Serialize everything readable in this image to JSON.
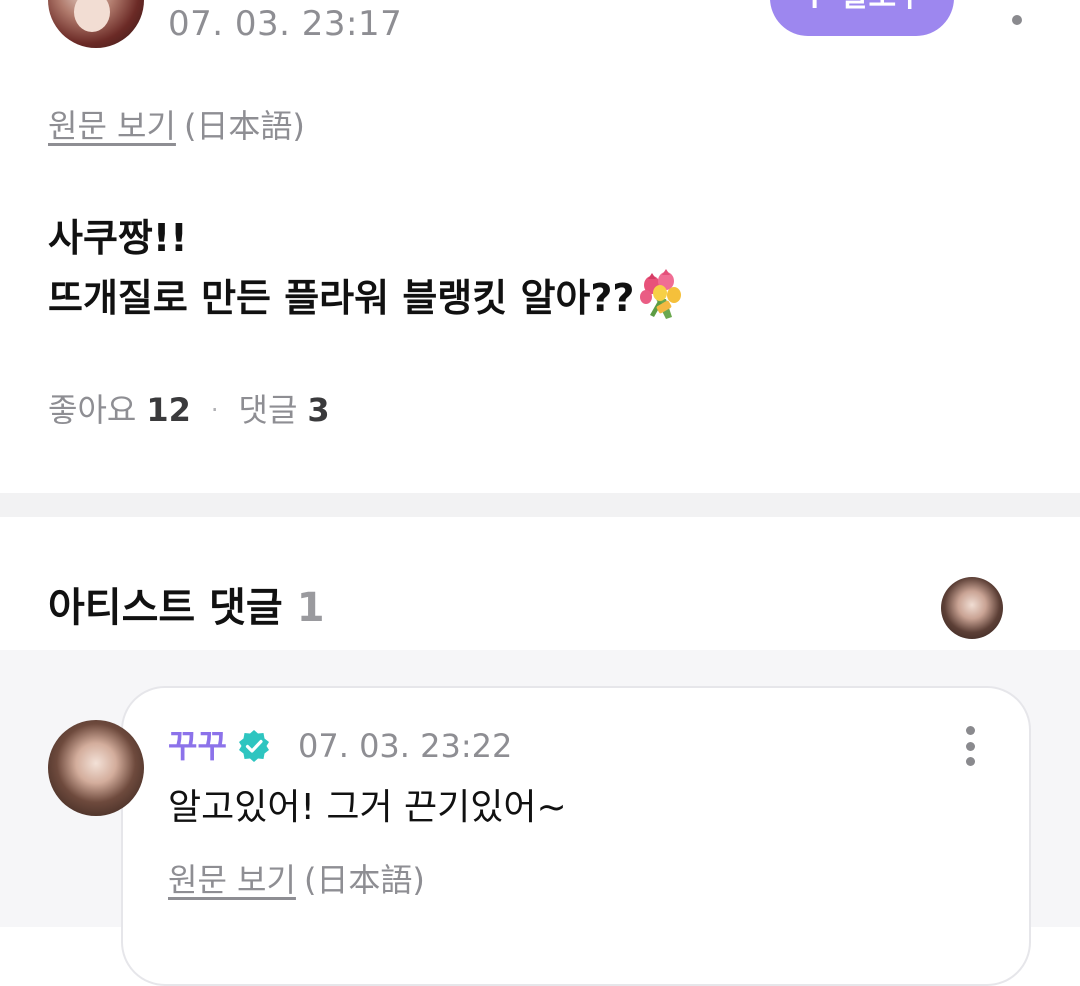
{
  "post": {
    "timestamp": "07. 03. 23:17",
    "follow_button": {
      "plus": "+",
      "label": "팔로우"
    },
    "original_link": "원문 보기",
    "original_lang": "(日本語)",
    "body_lines": [
      "사쿠짱!!",
      "뜨개질로 만든 플라워 블랭킷 알아??"
    ],
    "body_emoji": "bouquet-icon",
    "likes_label": "좋아요",
    "likes_count": "12",
    "separator": "·",
    "comments_label": "댓글",
    "comments_count": "3"
  },
  "artist_comments": {
    "title": "아티스트 댓글",
    "count": "1",
    "comment": {
      "author": "꾸꾸",
      "timestamp": "07. 03. 23:22",
      "text": "알고있어! 그거 끈기있어~",
      "original_link": "원문 보기",
      "original_lang": "(日本語)"
    }
  },
  "colors": {
    "accent": "#9d87ef",
    "author": "#8c72ea",
    "verified": "#2ec5c0",
    "muted_text": "#8e8e93"
  }
}
